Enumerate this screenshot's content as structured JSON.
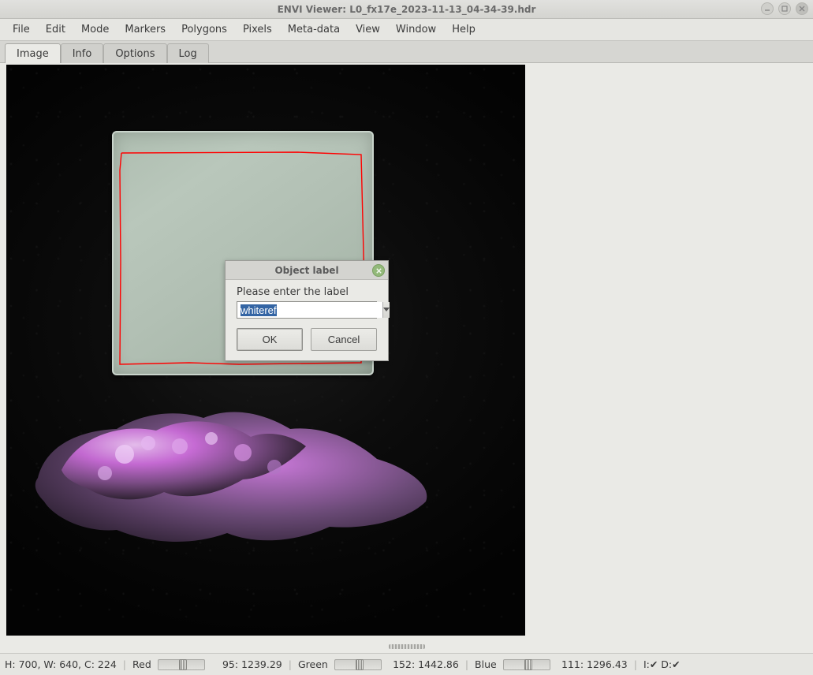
{
  "window": {
    "title": "ENVI Viewer: L0_fx17e_2023-11-13_04-34-39.hdr"
  },
  "menu": {
    "items": [
      "File",
      "Edit",
      "Mode",
      "Markers",
      "Polygons",
      "Pixels",
      "Meta-data",
      "View",
      "Window",
      "Help"
    ]
  },
  "tabs": {
    "items": [
      "Image",
      "Info",
      "Options",
      "Log"
    ],
    "active": "Image"
  },
  "dialog": {
    "title": "Object label",
    "prompt": "Please enter the label",
    "value": "whiteref",
    "ok": "OK",
    "cancel": "Cancel"
  },
  "status": {
    "dims": "H: 700, W: 640, C: 224",
    "red_label": "Red",
    "red_value": "95: 1239.29",
    "green_label": "Green",
    "green_value": "152: 1442.86",
    "blue_label": "Blue",
    "blue_value": "111: 1296.43",
    "flags": "I:✔ D:✔"
  }
}
